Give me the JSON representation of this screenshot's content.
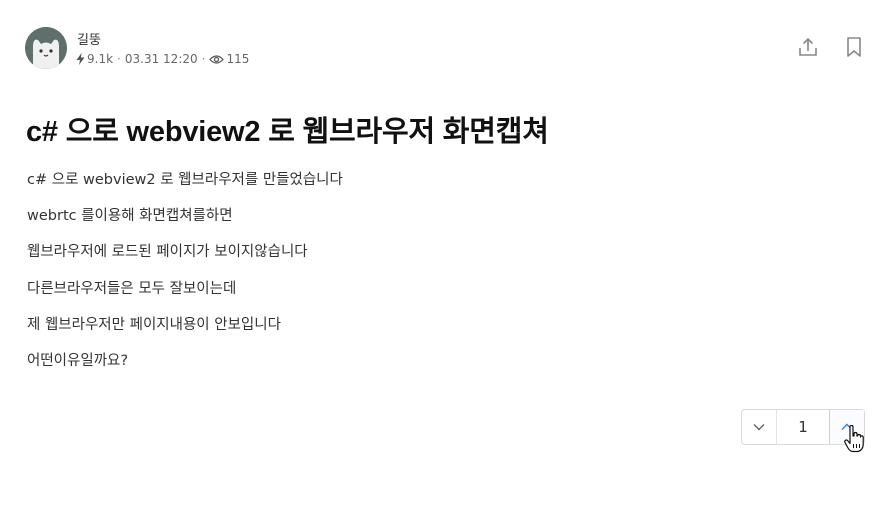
{
  "author": {
    "name": "길뚱",
    "avatar_icon": "cat-avatar-icon",
    "reputation": "9.1k",
    "date": "03.31 12:20",
    "views": "115",
    "reputation_icon": "lightning-icon",
    "views_icon": "eye-icon"
  },
  "actions": {
    "share_icon": "share-icon",
    "bookmark_icon": "bookmark-icon"
  },
  "post": {
    "title": "c# 으로 webview2 로 웹브라우저 화면캡쳐",
    "lines": [
      "c# 으로 webview2 로 웹브라우저를 만들었습니다",
      "webrtc 를이용해 화면캡쳐를하면",
      "웹브라우저에 로드된 페이지가 보이지않습니다",
      "다른브라우저들은 모두 잘보이는데",
      "제 웹브라우저만 페이지내용이 안보입니다",
      "어떤이유일까요?"
    ]
  },
  "vote": {
    "count": "1",
    "down_icon": "chevron-down-icon",
    "up_icon": "chevron-up-icon",
    "up_color": "#3b82f6"
  },
  "colors": {
    "avatar_bg": "#5f6f6c",
    "text": "#222222",
    "muted": "#666666",
    "border": "#d9d9d9"
  }
}
